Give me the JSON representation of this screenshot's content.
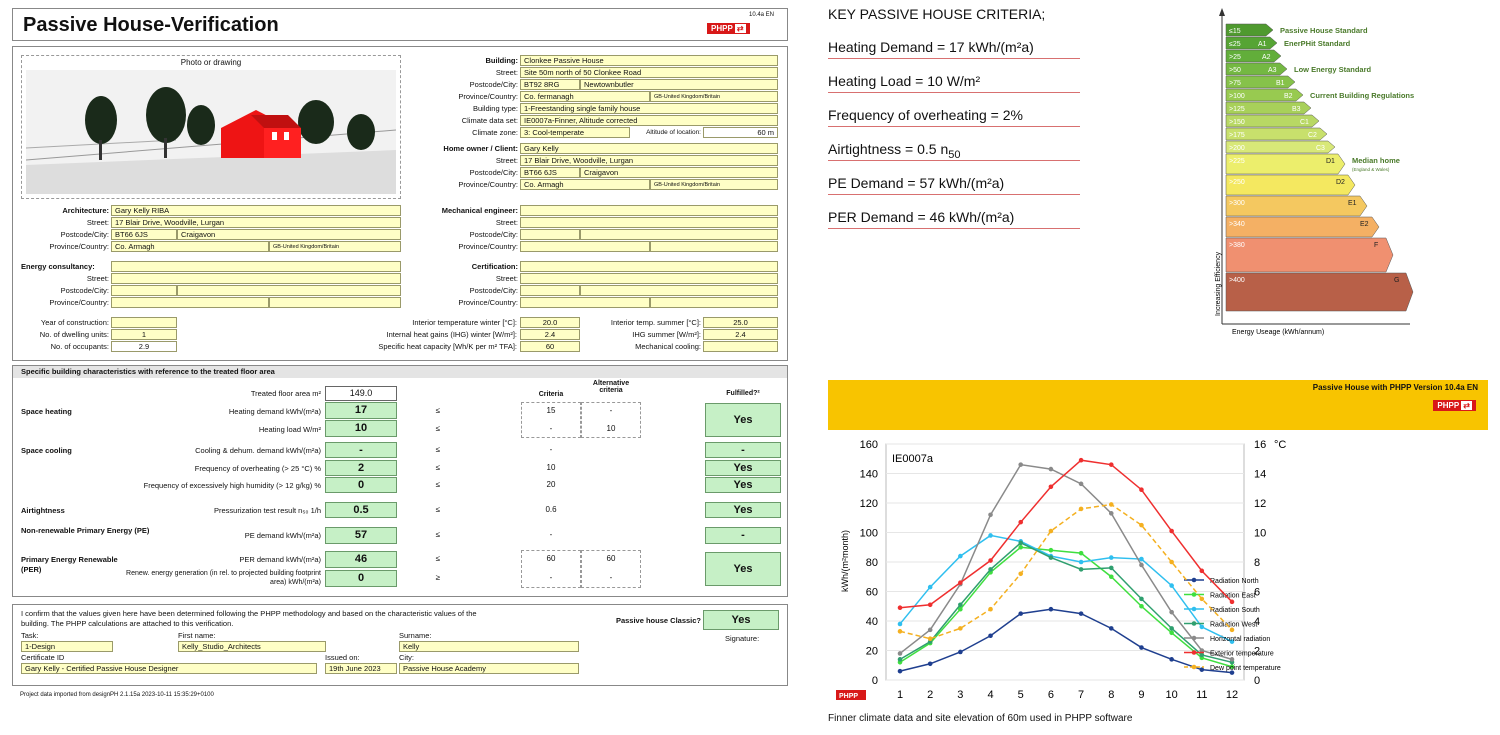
{
  "doc": {
    "title": "Passive House-Verification",
    "version": "10.4a EN",
    "phpp": "PHPP",
    "photo_label": "Photo or drawing",
    "building": {
      "label": "Building:",
      "value": "Clonkee Passive House"
    },
    "street": {
      "label": "Street:",
      "value": "Site 50m north of 50 Clonkee Road"
    },
    "postcode": {
      "label": "Postcode/City:",
      "value": "BT92 8RG",
      "city": "Newtownbutler"
    },
    "province": {
      "label": "Province/Country:",
      "value": "Co. fermanagh",
      "country": "GB-United Kingdom/Britain"
    },
    "building_type": {
      "label": "Building type:",
      "value": "1-Freestanding single family house"
    },
    "climate_data": {
      "label": "Climate data set:",
      "value": "IE0007a-Finner, Altitude corrected"
    },
    "climate_zone": {
      "label": "Climate zone:",
      "value": "3: Cool-temperate",
      "alt_label": "Altitude of location:",
      "alt_value": "60 m"
    },
    "owner": {
      "label": "Home owner / Client:",
      "value": "Gary Kelly",
      "street": "17 Blair Drive, Woodville, Lurgan",
      "postcode": "BT66 6JS",
      "city": "Craigavon",
      "province": "Co. Armagh",
      "country": "GB-United Kingdom/Britain"
    },
    "architecture": {
      "label": "Architecture:",
      "value": "Gary Kelly RIBA",
      "street": "17 Blair Drive, Woodville, Lurgan",
      "postcode": "BT66 6JS",
      "city": "Craigavon",
      "province": "Co. Armagh",
      "country": "GB-United Kingdom/Britain"
    },
    "mech_label": "Mechanical engineer:",
    "energy_label": "Energy consultancy:",
    "cert_label": "Certification:",
    "street_label": "Street:",
    "postcode_label": "Postcode/City:",
    "province_label": "Province/Country:",
    "year": {
      "label": "Year of construction:",
      "value": ""
    },
    "units": {
      "label": "No. of dwelling units:",
      "value": "1"
    },
    "occupants": {
      "label": "No. of occupants:",
      "value": "2.9"
    },
    "int_temp_winter": {
      "label": "Interior temperature winter [°C]:",
      "value": "20.0"
    },
    "ihg_winter": {
      "label": "Internal heat gains (IHG) winter [W/m²]:",
      "value": "2.4"
    },
    "heat_cap": {
      "label": "Specific heat capacity [Wh/K per m² TFA]:",
      "value": "60"
    },
    "int_temp_summer": {
      "label": "Interior temp. summer [°C]:",
      "value": "25.0"
    },
    "ihg_summer": {
      "label": "IHG summer [W/m²]:",
      "value": "2.4"
    },
    "mech_cooling": {
      "label": "Mechanical cooling:",
      "value": ""
    },
    "section_title": "Specific building characteristics with reference to the treated floor area",
    "tfa": {
      "label": "Treated floor area  m²",
      "value": "149.0"
    },
    "criteria_head": "Criteria",
    "alt_criteria_head": "Alternative criteria",
    "fulfilled_head": "Fulfilled?²",
    "space_heating": "Space heating",
    "heating_demand": {
      "label": "Heating demand  kWh/(m²a)",
      "value": "17",
      "op": "≤",
      "crit": "15",
      "alt": "-"
    },
    "heating_load": {
      "label": "Heating load  W/m²",
      "value": "10",
      "op": "≤",
      "crit": "-",
      "alt": "10"
    },
    "heating_ok": "Yes",
    "space_cooling": "Space cooling",
    "cooling_demand": {
      "label": "Cooling & dehum. demand  kWh/(m²a)",
      "value": "-",
      "op": "≤",
      "crit": "-",
      "alt": "",
      "ok": "-"
    },
    "overheating": {
      "label": "Frequency of overheating (> 25 °C)  %",
      "value": "2",
      "op": "≤",
      "crit": "10",
      "ok": "Yes"
    },
    "humidity": {
      "label": "Frequency of excessively high humidity (> 12 g/kg)  %",
      "value": "0",
      "op": "≤",
      "crit": "20",
      "ok": "Yes"
    },
    "airtight_title": "Airtightness",
    "airtight": {
      "label": "Pressurization test result n₅₀  1/h",
      "value": "0.5",
      "op": "≤",
      "crit": "0.6",
      "ok": "Yes"
    },
    "pe_title": "Non-renewable Primary Energy (PE)",
    "pe": {
      "label": "PE demand  kWh/(m²a)",
      "value": "57",
      "op": "≤",
      "crit": "-",
      "ok": "-"
    },
    "per_title": "Primary Energy Renewable (PER)",
    "per": {
      "label": "PER demand  kWh/(m²a)",
      "value": "46",
      "op": "≤",
      "crit": "60",
      "alt": "60",
      "ok": "Yes"
    },
    "renew": {
      "label": "Renew. energy generation (in rel. to projected building footprint area)  kWh/(m²a)",
      "value": "0",
      "op": "≥",
      "crit": "-",
      "alt": "-"
    },
    "confirm_text": "I confirm that the values given here have been determined following the PHPP methodology and based on the characteristic values of the building. The PHPP calculations are attached to this verification.",
    "classic": {
      "label": "Passive house Classic?",
      "value": "Yes"
    },
    "signature": "Signature:",
    "task": {
      "label": "Task:",
      "value": "1-Design"
    },
    "first": {
      "label": "First name:",
      "value": "Kelly_Studio_Architects"
    },
    "surname": {
      "label": "Surname:",
      "value": "Kelly"
    },
    "certid": {
      "label": "Certificate ID",
      "value": "Gary Kelly - Certified Passive House Designer"
    },
    "issued": {
      "label": "Issued on:",
      "value": "19th June 2023"
    },
    "city": {
      "label": "City:",
      "value": "Passive House Academy"
    },
    "footer": "Project data imported from designPH 2.1.15a 2023-10-11 15:35:29+0100"
  },
  "criteria": {
    "title": "KEY PASSIVE HOUSE CRITERIA;",
    "rows": [
      "Heating Demand = 17 kWh/(m²a)",
      "Heating Load = 10 W/m²",
      "Frequency of overheating = 2%",
      "Airtightness = 0.5 n",
      "PE Demand = 57 kWh/(m²a)",
      "PER Demand = 46 kWh/(m²a)"
    ],
    "sub50": "50"
  },
  "epc": {
    "bands": [
      {
        "code": "≤15",
        "grade": "",
        "color": "#4f9a2f",
        "len": 40,
        "note": "Passive House Standard"
      },
      {
        "code": "≤25",
        "grade": "A1",
        "color": "#56a434",
        "len": 44,
        "note": "EnerPHit Standard"
      },
      {
        "code": ">25",
        "grade": "A2",
        "color": "#62ae3a",
        "len": 48,
        "note": ""
      },
      {
        "code": ">50",
        "grade": "A3",
        "color": "#74b842",
        "len": 54,
        "note": "Low Energy Standard"
      },
      {
        "code": ">75",
        "grade": "B1",
        "color": "#86c24a",
        "len": 62,
        "note": ""
      },
      {
        "code": ">100",
        "grade": "B2",
        "color": "#98ca50",
        "len": 70,
        "note": "Current Building Regulations"
      },
      {
        "code": ">125",
        "grade": "B3",
        "color": "#a8d05a",
        "len": 78,
        "note": ""
      },
      {
        "code": ">150",
        "grade": "C1",
        "color": "#b8d864",
        "len": 86,
        "note": ""
      },
      {
        "code": ">175",
        "grade": "C2",
        "color": "#c8e06c",
        "len": 94,
        "note": ""
      },
      {
        "code": ">200",
        "grade": "C3",
        "color": "#d8e878",
        "len": 102,
        "note": ""
      },
      {
        "code": ">225",
        "grade": "D1",
        "color": "#ecee6c",
        "len": 112,
        "note": "Median home"
      },
      {
        "code": ">250",
        "grade": "D2",
        "color": "#f4e860",
        "len": 122,
        "note": ""
      },
      {
        "code": ">300",
        "grade": "E1",
        "color": "#f4c860",
        "len": 134,
        "note": ""
      },
      {
        "code": ">340",
        "grade": "E2",
        "color": "#f4b064",
        "len": 146,
        "note": ""
      },
      {
        "code": ">380",
        "grade": "F",
        "color": "#f09070",
        "len": 160,
        "note": ""
      },
      {
        "code": ">400",
        "grade": "G",
        "color": "#b86048",
        "len": 180,
        "note": ""
      }
    ],
    "median_sub": "(England & Wales)",
    "y_axis": "Increasing Efficiency",
    "x_axis": "Energy Useage (kWh/annum)"
  },
  "climate": {
    "header": "Passive House with PHPP Version 10.4a EN",
    "phpp": "PHPP",
    "caption": "Finner climate data and site elevation of 60m used in PHPP software"
  },
  "chart_data": {
    "type": "line",
    "title": "IE0007a",
    "x": [
      1,
      2,
      3,
      4,
      5,
      6,
      7,
      8,
      9,
      10,
      11,
      12
    ],
    "ylabel": "kWh/(m²month)",
    "ylim": [
      0,
      160
    ],
    "y2label": "°C",
    "y2lim": [
      0,
      16
    ],
    "yticks": [
      0,
      20,
      40,
      60,
      80,
      100,
      120,
      140,
      160
    ],
    "y2ticks": [
      0,
      2,
      4,
      6,
      8,
      10,
      12,
      14,
      16
    ],
    "series": [
      {
        "name": "Radiation North",
        "axis": "left",
        "color": "#1f3f8f",
        "dash": false,
        "values": [
          6,
          11,
          19,
          30,
          45,
          48,
          45,
          35,
          22,
          14,
          7,
          5
        ]
      },
      {
        "name": "Radiation East",
        "axis": "left",
        "color": "#3fdf3f",
        "dash": false,
        "values": [
          12,
          25,
          48,
          73,
          90,
          88,
          86,
          70,
          50,
          32,
          15,
          9
        ]
      },
      {
        "name": "Radiation South",
        "axis": "left",
        "color": "#2fbfef",
        "dash": false,
        "values": [
          38,
          63,
          84,
          98,
          94,
          84,
          80,
          83,
          82,
          64,
          36,
          26
        ]
      },
      {
        "name": "Radiation West",
        "axis": "left",
        "color": "#2f9f6f",
        "dash": false,
        "values": [
          14,
          26,
          51,
          75,
          93,
          83,
          75,
          76,
          55,
          35,
          17,
          12
        ]
      },
      {
        "name": "Horizontal radiation",
        "axis": "left",
        "color": "#8a8a8a",
        "dash": false,
        "values": [
          18,
          34,
          65,
          112,
          146,
          143,
          133,
          113,
          78,
          46,
          20,
          14
        ]
      },
      {
        "name": "Exterior temperature",
        "axis": "right",
        "color": "#ef2f2f",
        "dash": false,
        "values": [
          4.9,
          5.1,
          6.6,
          8.1,
          10.7,
          13.1,
          14.9,
          14.6,
          12.9,
          10.1,
          7.4,
          5.3
        ]
      },
      {
        "name": "Dew point temperature",
        "axis": "right",
        "color": "#f4b020",
        "dash": true,
        "values": [
          3.3,
          2.8,
          3.5,
          4.8,
          7.2,
          10.1,
          11.6,
          11.9,
          10.5,
          8.0,
          5.5,
          3.4
        ]
      }
    ]
  }
}
